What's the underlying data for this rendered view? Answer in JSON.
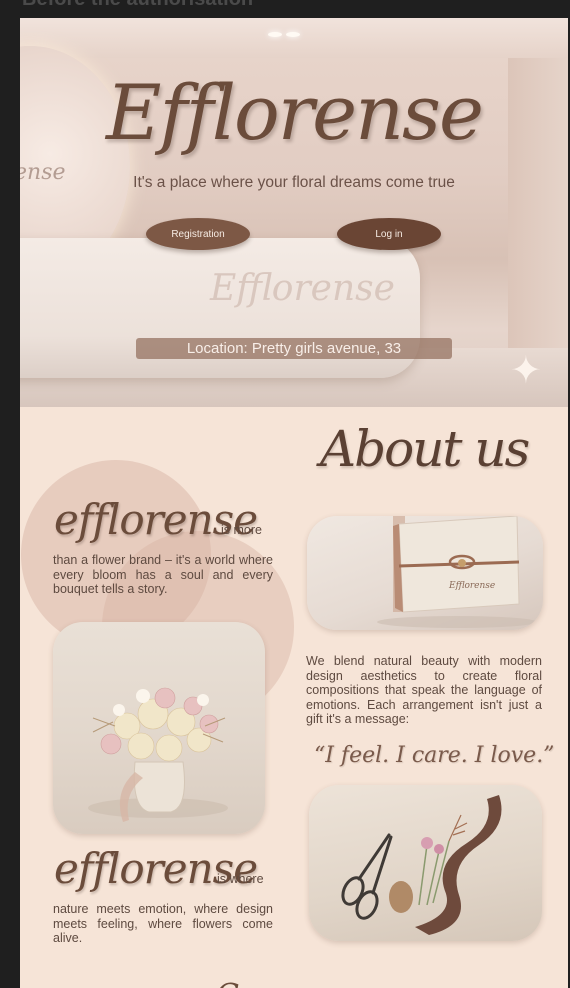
{
  "frame": {
    "title": "Before the authorisation"
  },
  "hero": {
    "brand": "Efflorense",
    "tagline": "It's a place where your floral dreams come true",
    "registration_button": "Registration",
    "login_button": "Log in",
    "location": "Location: Pretty girls avenue, 33",
    "counter_logo": "Efflorense",
    "wall_logo": "ense"
  },
  "about": {
    "title": "About us",
    "block1": {
      "script_word": "efflorense",
      "suffix": "is more",
      "text": "than a flower brand – it's a world where every bloom has a soul and every bouquet tells a story."
    },
    "box_label": "Efflorense",
    "block2_text": "We blend natural beauty with modern design aesthetics to create floral compositions that speak the language of emotions. Each arrangement isn't just a gift it's a message:",
    "quote": "“I feel. I care. I love.”",
    "block3": {
      "script_word": "efflorense",
      "suffix": "is where",
      "text": "nature meets emotion, where design meets feeling, where flowers come alive."
    },
    "bottom_glyph": "C"
  },
  "colors": {
    "accent": "#6b4c3b",
    "background": "#f6e4d7",
    "button": "#7d5845"
  }
}
